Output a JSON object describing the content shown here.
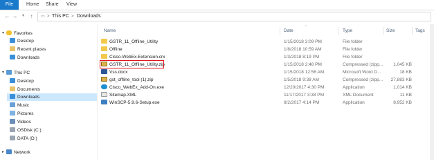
{
  "ribbon": {
    "tabs": [
      {
        "label": "File"
      },
      {
        "label": "Home"
      },
      {
        "label": "Share"
      },
      {
        "label": "View"
      }
    ]
  },
  "address": {
    "crumbs": [
      "This PC",
      "Downloads"
    ],
    "separator": ">"
  },
  "nav": {
    "favorites_label": "Favorites",
    "favorites": [
      {
        "label": "Desktop"
      },
      {
        "label": "Recent places"
      },
      {
        "label": "Downloads"
      }
    ],
    "thispc_label": "This PC",
    "thispc": [
      {
        "label": "Desktop"
      },
      {
        "label": "Documents"
      },
      {
        "label": "Downloads"
      },
      {
        "label": "Music"
      },
      {
        "label": "Pictures"
      },
      {
        "label": "Videos"
      },
      {
        "label": "OSDisk (C:)"
      },
      {
        "label": "DATA (D:)"
      }
    ],
    "network_label": "Network"
  },
  "columns": {
    "name": "Name",
    "date": "Date",
    "type": "Type",
    "size": "Size",
    "tags": "Tags"
  },
  "files": [
    {
      "name": "GSTR_11_Offline_Utility",
      "date": "1/15/2018 3:09 PM",
      "type": "File folder",
      "size": "",
      "icon": "folder-icon"
    },
    {
      "name": "Offline",
      "date": "1/8/2018 10:59 AM",
      "type": "File folder",
      "size": "",
      "icon": "folder-icon"
    },
    {
      "name": "Cisco-WebEx-Extension.crx",
      "date": "1/3/2018 8:19 PM",
      "type": "File folder",
      "size": "",
      "icon": "folder-icon"
    },
    {
      "name": "GSTR_11_Offline_Utility.zip",
      "date": "1/15/2018 2:48 PM",
      "type": "Compressed (zipp...",
      "size": "1,045 KB",
      "icon": "zip-icon"
    },
    {
      "name": "Vss.docx",
      "date": "1/15/2018 12:56 AM",
      "type": "Microsoft Word D...",
      "size": "18 KB",
      "icon": "word-icon"
    },
    {
      "name": "gst_offline_tool (1).zip",
      "date": "1/5/2018 9:38 AM",
      "type": "Compressed (zipp...",
      "size": "27,883 KB",
      "icon": "zip-icon"
    },
    {
      "name": "Cisco_WebEx_Add-On.exe",
      "date": "12/20/2017 4:30 PM",
      "type": "Application",
      "size": "1,014 KB",
      "icon": "exe-icon"
    },
    {
      "name": "Sitemap.XML",
      "date": "11/17/2017 3:38 PM",
      "type": "XML Document",
      "size": "11 KB",
      "icon": "xml-icon"
    },
    {
      "name": "WinSCP-5.9.6-Setup.exe",
      "date": "8/2/2017 4:14 PM",
      "type": "Application",
      "size": "8,952 KB",
      "icon": "exe-icon"
    }
  ]
}
